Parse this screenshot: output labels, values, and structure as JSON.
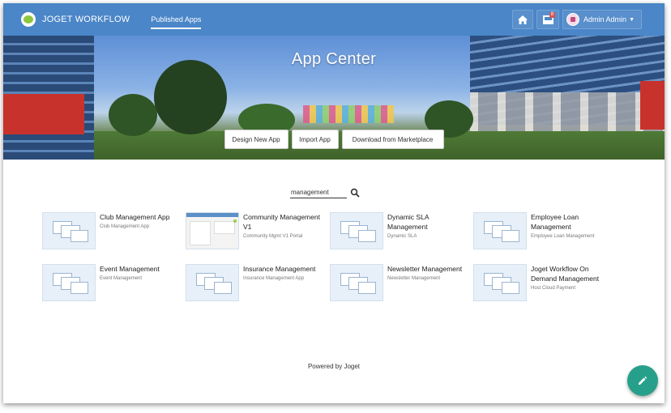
{
  "header": {
    "brand": "JOGET WORKFLOW",
    "tab_label": "Published Apps",
    "inbox_count": "8",
    "user_name": "Admin Admin"
  },
  "hero": {
    "title": "App Center",
    "buttons": {
      "design": "Design New App",
      "import": "Import App",
      "marketplace": "Download from Marketplace"
    }
  },
  "search": {
    "value": "management"
  },
  "apps": [
    {
      "name": "Club Management App",
      "desc": "Club Management App",
      "thumb": "diagram"
    },
    {
      "name": "Community Management V1",
      "desc": "Community Mgmt V1 Portal",
      "thumb": "screenshot"
    },
    {
      "name": "Dynamic SLA Management",
      "desc": "Dynamic SLA",
      "thumb": "diagram"
    },
    {
      "name": "Employee Loan Management",
      "desc": "Employee Loan Management",
      "thumb": "diagram"
    },
    {
      "name": "Event Management",
      "desc": "Event Management",
      "thumb": "diagram"
    },
    {
      "name": "Insurance Management",
      "desc": "Insurance Management App",
      "thumb": "diagram"
    },
    {
      "name": "Newsletter Management",
      "desc": "Newsletter Management",
      "thumb": "diagram"
    },
    {
      "name": "Joget Workflow On Demand Management",
      "desc": "Host Cloud Payment",
      "thumb": "diagram"
    }
  ],
  "footer": {
    "text": "Powered by Joget"
  },
  "colors": {
    "navbar": "#4a86c8",
    "fab": "#26a08a",
    "badge": "#d9534f"
  }
}
